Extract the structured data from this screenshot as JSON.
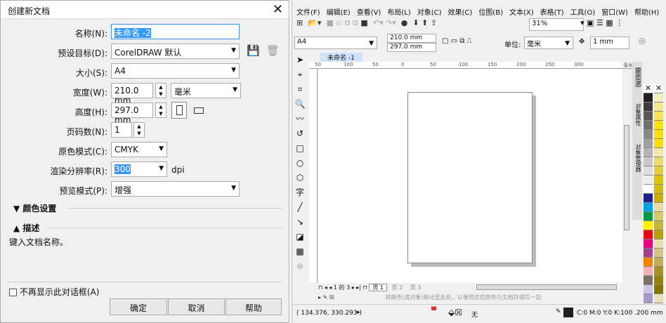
{
  "dialog": {
    "title": "创建新文档",
    "fields": [
      {
        "label": "名称(N):",
        "value": "未命名 -2"
      },
      {
        "label": "预设目标(D):",
        "value": "CorelDRAW 默认"
      },
      {
        "label": "大小(S):",
        "value": "A4"
      },
      {
        "label": "宽度(W):",
        "value": "210.0 mm",
        "unit": "毫米"
      },
      {
        "label": "高度(H):",
        "value": "297.0 mm"
      },
      {
        "label": "页码数(N):",
        "value": "1"
      },
      {
        "label": "原色模式(C):",
        "value": "CMYK"
      },
      {
        "label": "渲染分辨率(R):",
        "value": "300",
        "unit": "dpi"
      },
      {
        "label": "预览模式(P):",
        "value": "增强"
      }
    ],
    "color_settings": "颜色设置",
    "description": "描述",
    "description_text": "键入文档名称。",
    "dont_show": "不再显示此对话框(A)",
    "ok": "确定",
    "cancel": "取消",
    "help": "帮助"
  },
  "app": {
    "menu": [
      "文件(F)",
      "编辑(E)",
      "查看(V)",
      "布局(L)",
      "对象(C)",
      "效果(C)",
      "位图(B)",
      "文本(X)",
      "表格(T)",
      "工具(O)",
      "窗口(W)",
      "帮助(H)"
    ],
    "zoom": "31%",
    "page_size": "A4",
    "width": "210.0 mm",
    "height": "297.0 mm",
    "units_label": "单位:",
    "units": "毫米",
    "nudge": "1 mm",
    "doc_tab": "未命名 -1",
    "ruler": [
      "50",
      "100",
      "50",
      "0",
      "50",
      "100",
      "150",
      "200",
      "250",
      "300"
    ],
    "ruler_unit": "毫米",
    "page_nav": {
      "current": "1",
      "of": "的",
      "total": "3"
    },
    "pages": [
      "页 1",
      "页 2",
      "页 3"
    ],
    "palette_hint": "将颜色(或对象)拖动至此处，以便将这些颜色与文档存储在一起",
    "coords": "( 134.376, 330.293 )",
    "fill_label": "无",
    "outline": "C:0 M:0 Y:0 K:100 .200 mm",
    "dockers": [
      "提示(N)",
      "对象属性",
      "对象管理器"
    ],
    "palette1": [
      "#231f20",
      "#3d3b3c",
      "#595757",
      "#717071",
      "#898989",
      "#9fa0a0",
      "#b5b5b6",
      "#c9caca",
      "#dcdddd",
      "#eeeeee",
      "#ffffff",
      "#1d2088",
      "#00a0e9",
      "#009944",
      "#fff100",
      "#e60012",
      "#e4007f",
      "#a5408e",
      "#f08300",
      "#f4b3b2",
      "#7d6f66",
      "#c9c7e4",
      "#a69bc9"
    ],
    "palette2": [
      "#f3eebd",
      "#f6e98c",
      "#f7e45c",
      "#fce300",
      "#ffe100",
      "#ffde00",
      "#f2e8a8",
      "#eedb6b",
      "#e6cf3a",
      "#dcc400",
      "#d7bd00",
      "#cbb000",
      "#e6dba0",
      "#d9c96a",
      "#c9b43a",
      "#b8a000",
      "#e9dfae",
      "#d6c785",
      "#c2ad58",
      "#a89122",
      "#9a8200",
      "#8a7300",
      "#e8e0b8"
    ]
  }
}
